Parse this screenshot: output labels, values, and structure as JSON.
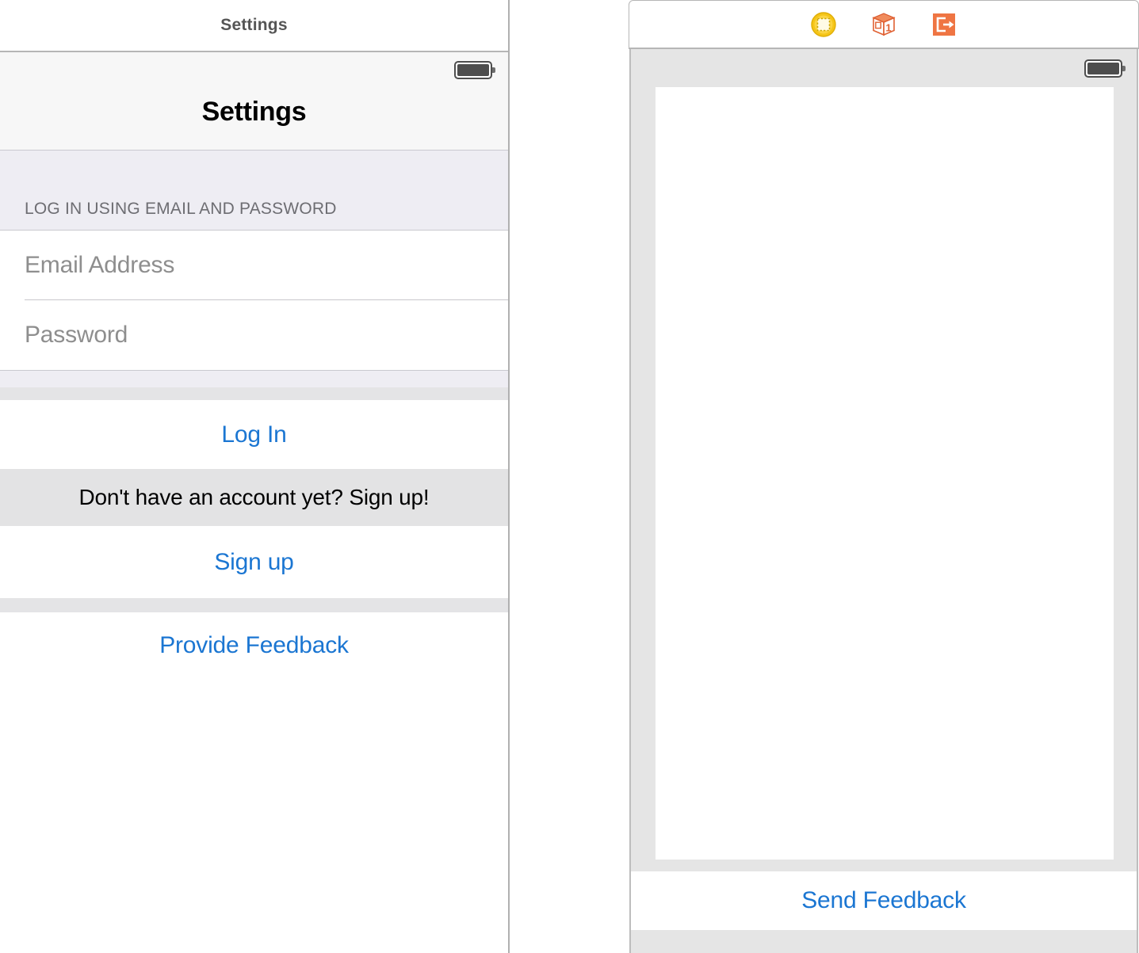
{
  "left_panel": {
    "window_title": "Settings",
    "nav_title": "Settings",
    "battery_icon": "battery-full-icon",
    "section_header": "LOG IN USING EMAIL AND PASSWORD",
    "fields": [
      {
        "name": "email",
        "placeholder": "Email Address",
        "value": ""
      },
      {
        "name": "password",
        "placeholder": "Password",
        "value": ""
      }
    ],
    "log_in_label": "Log In",
    "signup_prompt": "Don't have an account yet? Sign up!",
    "sign_up_label": "Sign up",
    "provide_feedback_label": "Provide Feedback"
  },
  "right_panel": {
    "toolbar_icons": [
      {
        "name": "selection-marquee-icon",
        "color": "#f5c518"
      },
      {
        "name": "package-box-one-icon",
        "color": "#ec6730"
      },
      {
        "name": "export-logout-icon",
        "color": "#ef7543"
      }
    ],
    "battery_icon": "battery-full-icon",
    "send_feedback_label": "Send Feedback"
  },
  "colors": {
    "accent_blue": "#1b76d2",
    "section_lavender": "#eeedf3",
    "group_gray": "#e4e4e6",
    "info_row_gray": "#e3e3e4",
    "placeholder_gray": "#8e8e8e",
    "section_label_gray": "#6d6d72",
    "icon_yellow": "#f5c518",
    "icon_orange": "#ec6730",
    "icon_orange_light": "#ef7543"
  }
}
